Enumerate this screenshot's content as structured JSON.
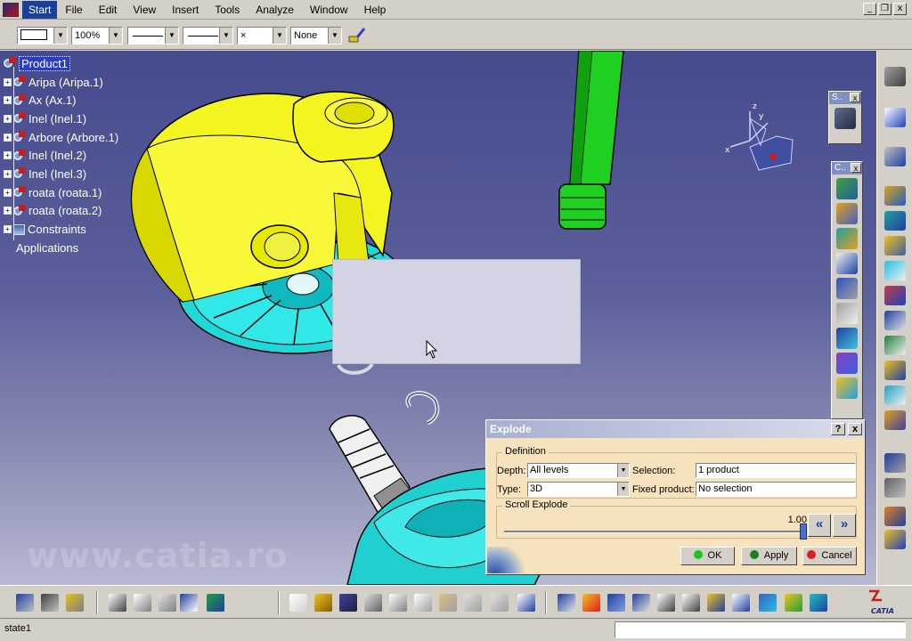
{
  "menubar": {
    "items": [
      "Start",
      "File",
      "Edit",
      "View",
      "Insert",
      "Tools",
      "Analyze",
      "Window",
      "Help"
    ],
    "active": "Start",
    "window_controls": [
      "_",
      "❐",
      "x"
    ]
  },
  "property_toolbar": {
    "zoom": "100%",
    "none_label": "None",
    "point_symbol": "×"
  },
  "tree": {
    "root": "Product1",
    "items": [
      "Aripa (Aripa.1)",
      "Ax (Ax.1)",
      "Inel (Inel.1)",
      "Arbore (Arbore.1)",
      "Inel (Inel.2)",
      "Inel (Inel.3)",
      "roata (roata.1)",
      "roata (roata.2)"
    ],
    "constraints": "Constraints",
    "applications": "Applications"
  },
  "compass_axes": {
    "z": "z",
    "y": "y",
    "x": "x"
  },
  "watermark": "www.catia.ro",
  "float_toolbars": {
    "small_title": "S..",
    "tall_title": "C.."
  },
  "dialog": {
    "title": "Explode",
    "help": "?",
    "close": "x",
    "definition_label": "Definition",
    "depth_label": "Depth:",
    "depth_value": "All levels",
    "type_label": "Type:",
    "type_value": "3D",
    "selection_label": "Selection:",
    "selection_value": "1 product",
    "fixed_label": "Fixed product:",
    "fixed_value": "No selection",
    "scroll_label": "Scroll Explode",
    "scroll_value": "1.00",
    "ok": "OK",
    "apply": "Apply",
    "cancel": "Cancel"
  },
  "statusbar": {
    "text": "state1"
  },
  "brand": "CATIA",
  "colors": {
    "viewport_top": "#454b8e",
    "yellow_part": "#f0f020",
    "cyan_part": "#20e0e0",
    "green_part": "#20d020",
    "selection": "#2a3fc0"
  }
}
